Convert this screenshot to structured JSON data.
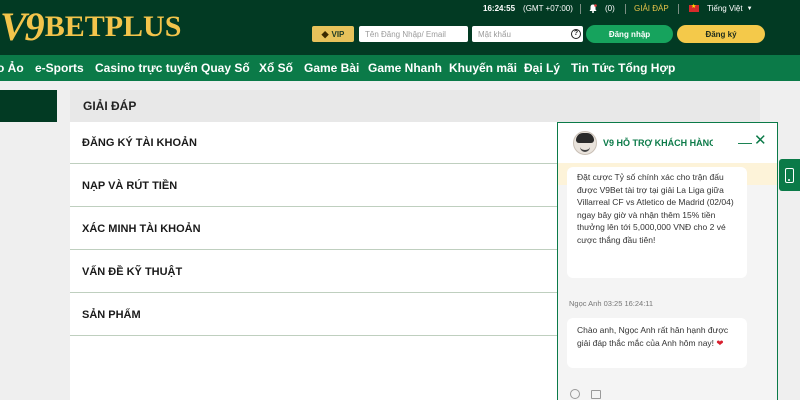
{
  "header": {
    "logo_mark": "V9",
    "logo_text": "BETPLUS",
    "time": "16:24:55",
    "timezone": "(GMT +07:00)",
    "notification_count": "(0)",
    "support_link": "GIẢI ĐÁP",
    "language": "Tiếng Việt",
    "vip_label": "VIP",
    "username_placeholder": "Tên Đăng Nhập/ Email",
    "password_placeholder": "Mật khẩu",
    "login_label": "Đăng nhập",
    "register_label": "Đăng ký"
  },
  "nav": {
    "items": [
      "o Ảo",
      "e-Sports",
      "Casino trực tuyến",
      "Quay Số",
      "Xổ Số",
      "Game Bài",
      "Game Nhanh",
      "Khuyến mãi",
      "Đại Lý",
      "Tin Tức Tổng Hợp"
    ]
  },
  "faq": {
    "title": "GIẢI ĐÁP",
    "items": [
      "ĐĂNG KÝ TÀI KHOẢN",
      "NẠP VÀ RÚT TIỀN",
      "XÁC MINH TÀI KHOẢN",
      "VẤN ĐỀ KỸ THUẬT",
      "SẢN PHẨM"
    ]
  },
  "chat": {
    "title": "V9 HỖ TRỢ KHÁCH HÀNG",
    "message1": "Đặt cược Tỷ số chính xác cho trận đấu được V9Bet tài trợ tại giải La Liga giữa Villarreal CF vs Atletico de Madrid (02/04) ngay bây giờ và nhận thêm 15% tiền thưởng lên tới 5,000,000 VNĐ cho 2 vé cược thắng đầu tiên!",
    "sender": "Ngọc Anh 03:25 16:24:11",
    "message2": "Chào anh, Ngọc Anh rất hân hạnh được giải đáp thắc mắc của Anh hôm nay!",
    "message2_emoji": "❤"
  },
  "icons": {
    "bell": "bell-icon",
    "eye": "help-icon",
    "speaker": "speaker-icon",
    "phone": "phone-icon"
  },
  "colors": {
    "header_bg": "#023a23",
    "nav_bg": "#0b7a48",
    "accent_gold": "#f4c94a",
    "login_green": "#16a35d"
  }
}
